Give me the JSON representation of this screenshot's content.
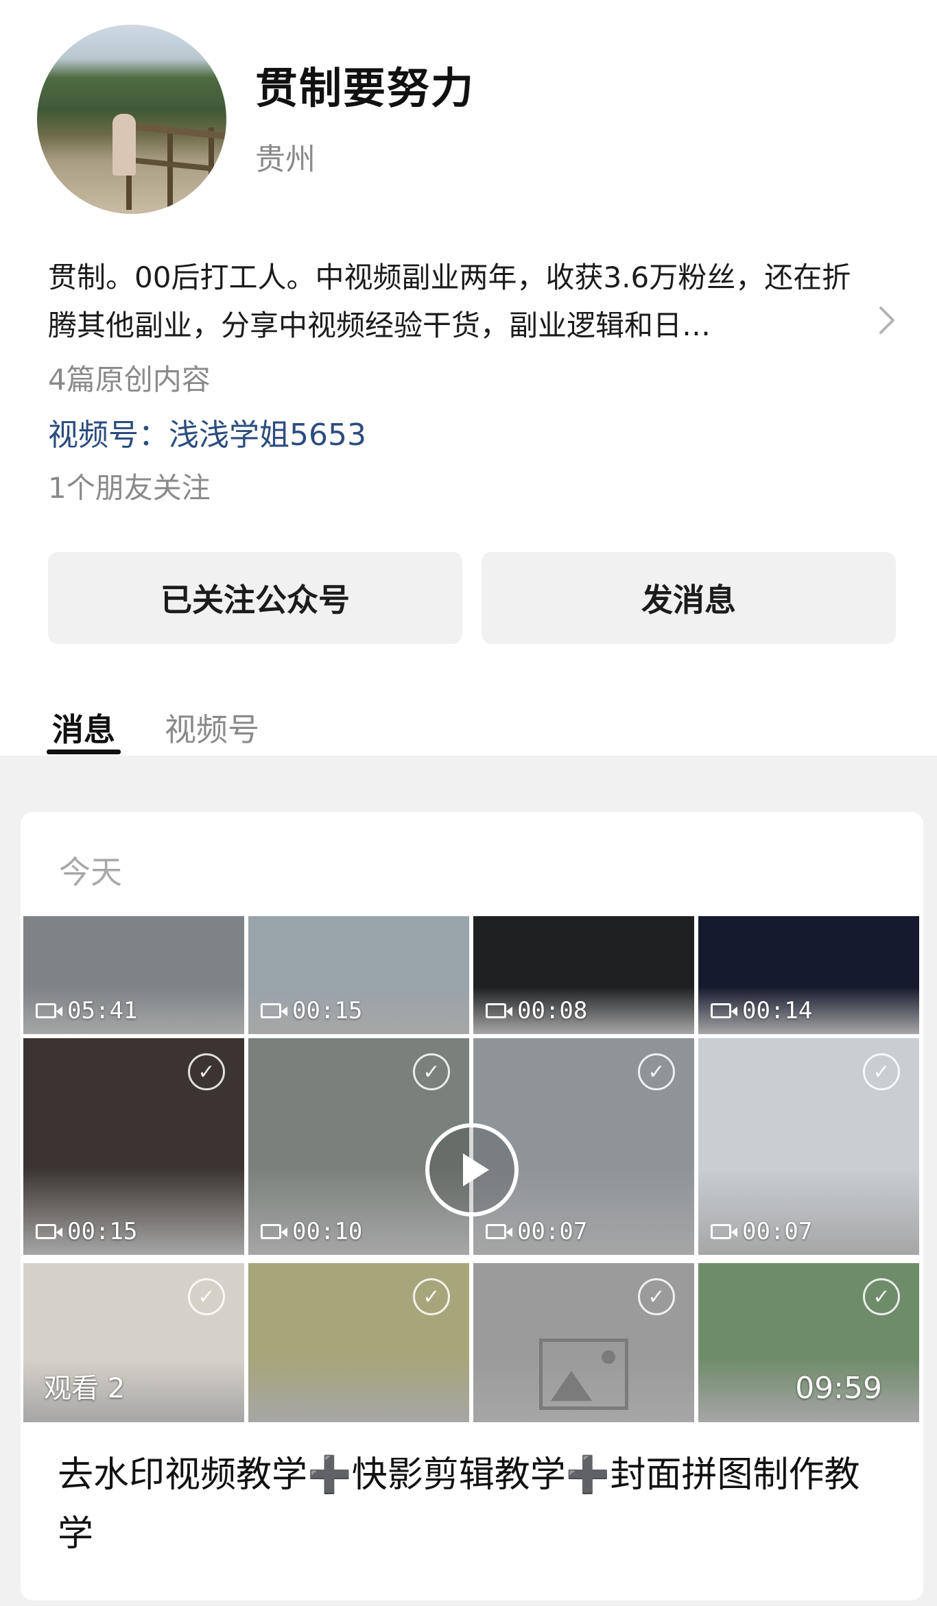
{
  "profile": {
    "nickname": "贯制要努力",
    "region": "贵州",
    "bio": "贯制。00后打工人。中视频副业两年，收获3.6万粉丝，还在折腾其他副业，分享中视频经验干货，副业逻辑和日…",
    "articles": "4篇原创内容",
    "channel": "视频号：浅浅学姐5653",
    "friends_following": "1个朋友关注"
  },
  "actions": {
    "follow_label": "已关注公众号",
    "message_label": "发消息"
  },
  "tabs": [
    {
      "label": "消息"
    },
    {
      "label": "视频号"
    }
  ],
  "feed": {
    "date": "今天",
    "thumbs": [
      {
        "duration": "05:41",
        "bg": "#7d8386"
      },
      {
        "duration": "00:15",
        "bg": "#9aa4ab"
      },
      {
        "duration": "00:08",
        "bg": "#1e2022"
      },
      {
        "duration": "00:14",
        "bg": "#151a2e"
      },
      {
        "duration": "00:15",
        "bg": "#3b3430"
      },
      {
        "duration": "00:10",
        "bg": "#7a817c"
      },
      {
        "duration": "00:07",
        "bg": "#8f9499"
      },
      {
        "duration": "00:07",
        "bg": "#c9ced3"
      },
      {
        "views": "观看 2",
        "bg": "#d6d1c8"
      },
      {
        "bg": "#a7a67b"
      },
      {
        "bg": "#9b9b9b"
      },
      {
        "duration_plain": "09:59",
        "bg": "#6f8c6a"
      }
    ],
    "caption": "去水印视频教学➕快影剪辑教学➕封面拼图制作教学"
  }
}
